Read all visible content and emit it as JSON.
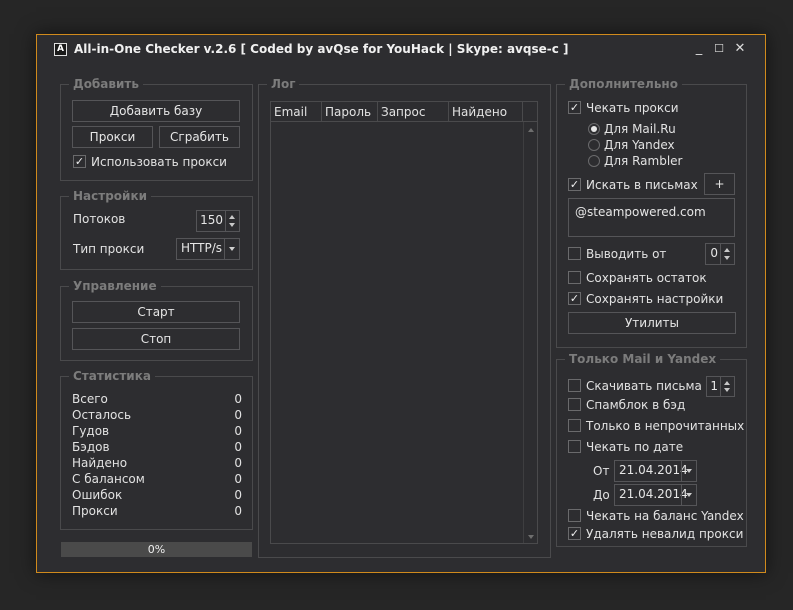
{
  "window": {
    "title": "All-in-One Checker v.2.6  [ Coded by avQse for YouHack | Skype: avqse-c ]",
    "app_icon": "A",
    "controls": {
      "minimize": "_",
      "maximize": "☐",
      "close": "✕"
    }
  },
  "add_group": {
    "title": "Добавить",
    "add_base_label": "Добавить базу",
    "proxy_label": "Прокси",
    "grab_label": "Сграбить",
    "use_proxy_label": "Использовать прокси",
    "use_proxy_checked": true
  },
  "settings_group": {
    "title": "Настройки",
    "threads_label": "Потоков",
    "threads_value": "150",
    "proxy_type_label": "Тип прокси",
    "proxy_type_value": "HTTP/s"
  },
  "control_group": {
    "title": "Управление",
    "start_label": "Старт",
    "stop_label": "Стоп"
  },
  "stats_group": {
    "title": "Статистика",
    "rows": [
      {
        "label": "Всего",
        "value": "0"
      },
      {
        "label": "Осталось",
        "value": "0"
      },
      {
        "label": "Гудов",
        "value": "0"
      },
      {
        "label": "Бэдов",
        "value": "0"
      },
      {
        "label": "Найдено",
        "value": "0"
      },
      {
        "label": "С балансом",
        "value": "0"
      },
      {
        "label": "Ошибок",
        "value": "0"
      },
      {
        "label": "Прокси",
        "value": "0"
      }
    ]
  },
  "progress": {
    "text": "0%",
    "fraction": 0
  },
  "log_group": {
    "title": "Лог",
    "columns": [
      "Email",
      "Пароль",
      "Запрос",
      "Найдено"
    ]
  },
  "extra_group": {
    "title": "Дополнительно",
    "check_proxy_label": "Чекать прокси",
    "check_proxy_checked": true,
    "radios": [
      {
        "label": "Для Mail.Ru",
        "selected": true
      },
      {
        "label": "Для Yandex",
        "selected": false
      },
      {
        "label": "Для Rambler",
        "selected": false
      }
    ],
    "search_letters_label": "Искать в письмах",
    "search_letters_checked": true,
    "plus_label": "+",
    "search_text": "@steampowered.com",
    "output_from_label": "Выводить от",
    "output_from_checked": false,
    "output_from_value": "0",
    "save_rest_label": "Сохранять остаток",
    "save_rest_checked": false,
    "save_settings_label": "Сохранять настройки",
    "save_settings_checked": true,
    "utilities_label": "Утилиты"
  },
  "mail_yandex_group": {
    "title": "Только Mail и Yandex",
    "download_letters_label": "Скачивать письма",
    "download_letters_checked": false,
    "download_letters_value": "1",
    "spamblock_label": "Спамблок в бэд",
    "spamblock_checked": false,
    "unread_only_label": "Только в непрочитанных",
    "unread_only_checked": false,
    "check_by_date_label": "Чекать по дате",
    "check_by_date_checked": false,
    "from_label": "От",
    "from_value": "21.04.2014",
    "to_label": "До",
    "to_value": "21.04.2014",
    "yandex_balance_label": "Чекать на баланс Yandex",
    "yandex_balance_checked": false,
    "delete_invalid_proxy_label": "Удалять невалид прокси",
    "delete_invalid_proxy_checked": true
  }
}
